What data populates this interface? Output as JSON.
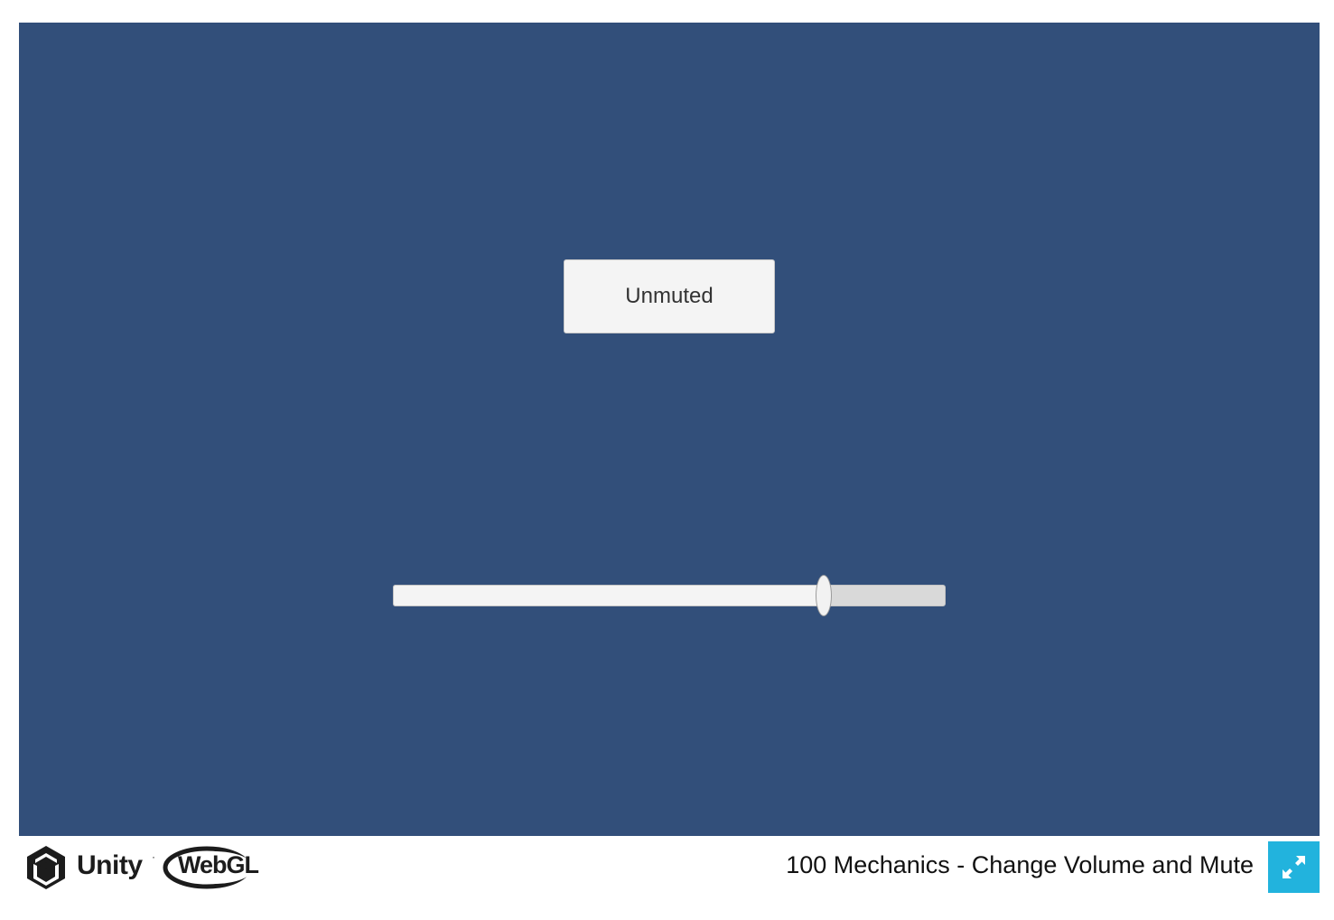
{
  "game": {
    "background_color": "#324f7a",
    "mute_button_label": "Unmuted",
    "volume_slider_value": 0.78
  },
  "footer": {
    "unity_logo_text": "Unity",
    "webgl_logo_text": "WebGL",
    "title": "100 Mechanics - Change Volume and Mute",
    "fullscreen_icon": "fullscreen-icon",
    "fullscreen_button_color": "#22b3dd"
  }
}
